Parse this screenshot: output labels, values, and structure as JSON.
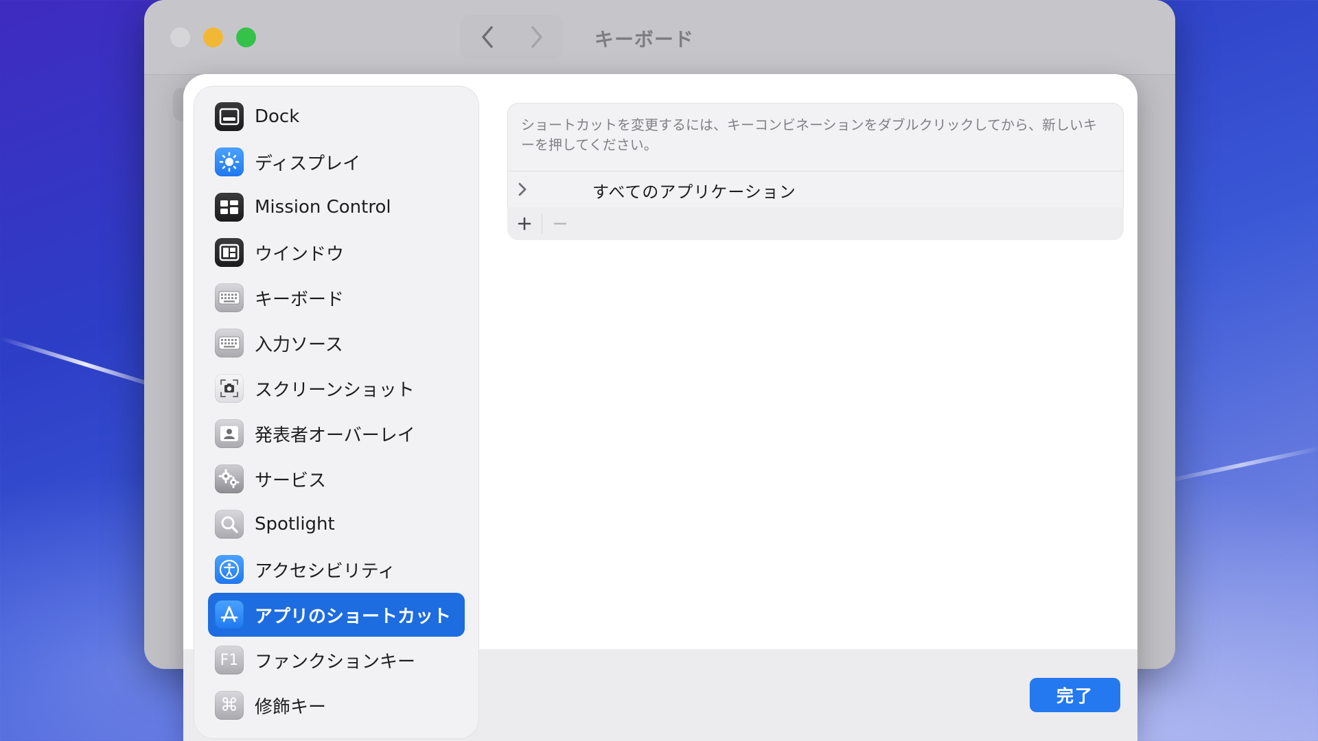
{
  "window": {
    "title": "キーボード"
  },
  "sidebar": {
    "items": [
      {
        "label": "Dock",
        "icon": "dock-icon"
      },
      {
        "label": "ディスプレイ",
        "icon": "display-brightness-icon"
      },
      {
        "label": "Mission Control",
        "icon": "mission-control-icon"
      },
      {
        "label": "ウインドウ",
        "icon": "window-icon"
      },
      {
        "label": "キーボード",
        "icon": "keyboard-icon"
      },
      {
        "label": "入力ソース",
        "icon": "input-source-icon"
      },
      {
        "label": "スクリーンショット",
        "icon": "screenshot-icon"
      },
      {
        "label": "発表者オーバーレイ",
        "icon": "presenter-overlay-icon"
      },
      {
        "label": "サービス",
        "icon": "services-gear-icon"
      },
      {
        "label": "Spotlight",
        "icon": "spotlight-search-icon"
      },
      {
        "label": "アクセシビリティ",
        "icon": "accessibility-icon"
      },
      {
        "label": "アプリのショートカット",
        "icon": "app-shortcuts-icon",
        "selected": true
      },
      {
        "label": "ファンクションキー",
        "icon": "function-key-icon",
        "glyph": "F1"
      },
      {
        "label": "修飾キー",
        "icon": "modifier-keys-icon",
        "glyph": "⌘"
      }
    ]
  },
  "content": {
    "instructions": "ショートカットを変更するには、キーコンビネーションをダブルクリックしてから、新しいキーを押してください。",
    "app_row_label": "すべてのアプリケーション"
  },
  "footer": {
    "done_label": "完了"
  },
  "colors": {
    "accent": "#1d6ce0",
    "done_button": "#2478f0",
    "close_light": "#d6d6d8",
    "minimize_light": "#f2b835",
    "maximize_light": "#35c24a"
  }
}
